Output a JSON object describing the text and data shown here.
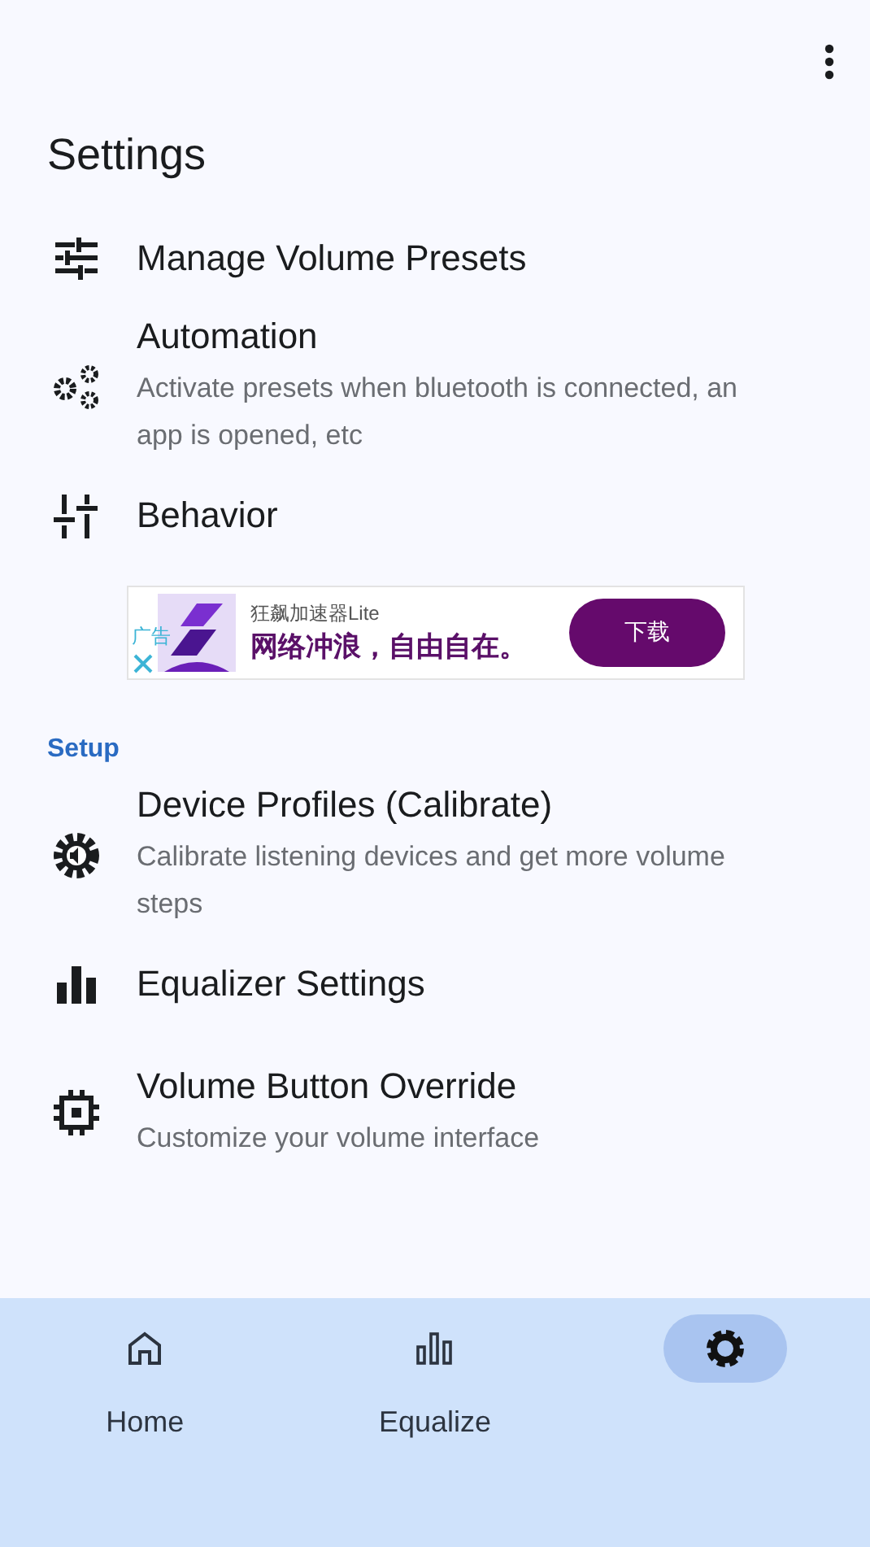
{
  "title": "Settings",
  "sections": [
    {
      "items": [
        {
          "title": "Manage Volume Presets"
        },
        {
          "title": "Automation",
          "subtitle": "Activate presets when bluetooth is connected, an app is opened, etc"
        },
        {
          "title": "Behavior"
        }
      ]
    },
    {
      "header": "Setup",
      "items": [
        {
          "title": "Device Profiles (Calibrate)",
          "subtitle": "Calibrate listening devices and get more volume steps"
        },
        {
          "title": "Equalizer Settings"
        },
        {
          "title": "Volume Button Override",
          "subtitle": "Customize your volume interface"
        }
      ]
    }
  ],
  "ad": {
    "tag": "广告",
    "app_name": "狂飙加速器Lite",
    "headline": "网络冲浪，自由自在。",
    "button": "下载"
  },
  "nav": [
    {
      "label": "Home",
      "selected": false
    },
    {
      "label": "Equalize",
      "selected": false
    },
    {
      "selected": true
    }
  ]
}
